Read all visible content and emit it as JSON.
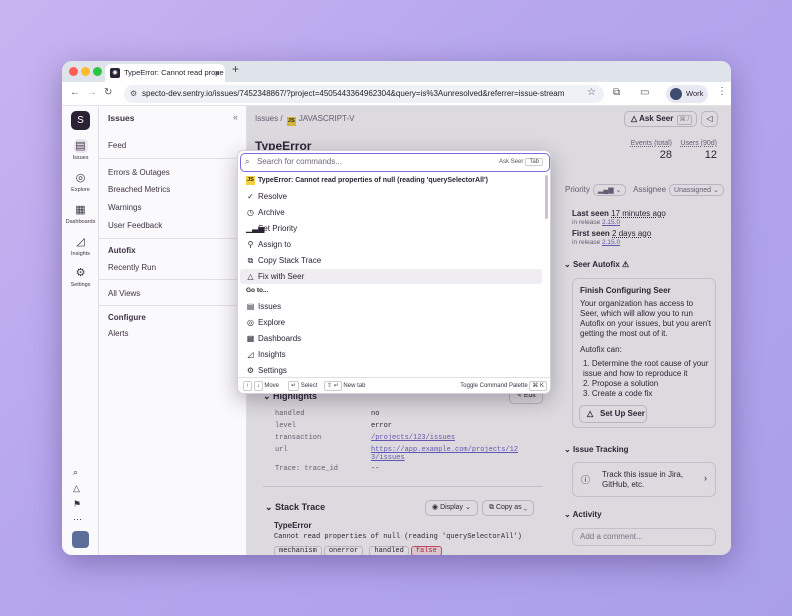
{
  "browser": {
    "tab_title": "TypeError: Cannot read prope",
    "url": "specto-dev.sentry.io/issues/7452348867/?project=4505443364962304&query=is%3Aunresolved&referrer=issue-stream",
    "profile": "Work"
  },
  "nav": {
    "items": [
      {
        "label": "Issues"
      },
      {
        "label": "Explore"
      },
      {
        "label": "Dashboards"
      },
      {
        "label": "Insights"
      },
      {
        "label": "Settings"
      }
    ]
  },
  "sidebar": {
    "title": "Issues",
    "items": [
      "Feed",
      "Errors & Outages",
      "Breached Metrics",
      "Warnings",
      "User Feedback"
    ],
    "autofix_title": "Autofix",
    "autofix_items": [
      "Recently Run"
    ],
    "all_views": "All Views",
    "configure_title": "Configure",
    "configure_items": [
      "Alerts"
    ]
  },
  "issue": {
    "breadcrumb_root": "Issues",
    "breadcrumb_project": "JAVASCRIPT-V",
    "title": "TypeError",
    "ask_seer": "Ask Seer",
    "ask_seer_kbd": "⌘ /",
    "events_label": "Events (total)",
    "events_value": "28",
    "users_label": "Users (90d)",
    "users_value": "12",
    "priority_label": "Priority",
    "assignee_label": "Assignee",
    "assignee_value": "Unassigned"
  },
  "right_panel": {
    "last_seen": "Last seen",
    "last_seen_value": "17 minutes ago",
    "last_release_label": "in release",
    "last_release": "2.15.0",
    "first_seen": "First seen",
    "first_seen_value": "2 days ago",
    "first_release": "2.15.0",
    "seer_autofix": "Seer Autofix",
    "card_title": "Finish Configuring Seer",
    "card_body": "Your organization has access to Seer, which will allow you to run Autofix on your issues, but you aren't getting the most out of it.",
    "autofix_can": "Autofix can:",
    "autofix_list": [
      "Determine the root cause of your issue and how to reproduce it",
      "Propose a solution",
      "Create a code fix"
    ],
    "setup_button": "Set Up Seer",
    "issue_tracking": "Issue Tracking",
    "tracking_text": "Track this issue in Jira, GitHub, etc.",
    "activity": "Activity",
    "comment_placeholder": "Add a comment..."
  },
  "highlights": {
    "title": "Highlights",
    "edit": "Edit",
    "rows": [
      {
        "k": "handled",
        "v": "no"
      },
      {
        "k": "level",
        "v": "error"
      },
      {
        "k": "transaction",
        "v": "/projects/123/issues"
      },
      {
        "k": "url",
        "v": "https://app.example.com/projects/123/issues"
      }
    ],
    "trace": "Trace: trace_id",
    "trace_value": "--"
  },
  "stacktrace": {
    "title": "Stack Trace",
    "display": "Display",
    "copy_as": "Copy as",
    "exc_type": "TypeError",
    "exc_msg": "Cannot read properties of null (reading 'querySelectorAll')",
    "tags": [
      {
        "k": "mechanism",
        "v": "onerror"
      },
      {
        "k": "handled",
        "v": "false"
      }
    ]
  },
  "palette": {
    "placeholder": "Search for commands...",
    "ask_seer": "Ask Seer",
    "tab_key": "Tab",
    "issue_row": "TypeError: Cannot read properties of null (reading 'querySelectorAll')",
    "actions": [
      "Resolve",
      "Archive",
      "Set Priority",
      "Assign to",
      "Copy Stack Trace",
      "Fix with Seer"
    ],
    "goto_label": "Go to...",
    "goto": [
      "Issues",
      "Explore",
      "Dashboards",
      "Insights",
      "Settings"
    ],
    "footer_move": "Move",
    "footer_select": "Select",
    "footer_newtab": "New tab",
    "footer_toggle": "Toggle Command Palette",
    "footer_toggle_kbd": "⌘ K"
  }
}
